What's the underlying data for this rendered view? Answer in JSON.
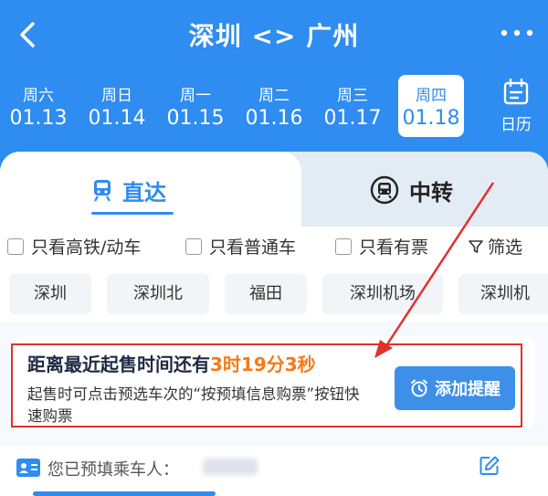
{
  "header": {
    "title": "深圳 <> 广州",
    "back_icon": "chevron-left-icon",
    "more_icon": "more-icon"
  },
  "dates": [
    {
      "weekday": "周六",
      "date": "01.13",
      "active": false
    },
    {
      "weekday": "周日",
      "date": "01.14",
      "active": false
    },
    {
      "weekday": "周一",
      "date": "01.15",
      "active": false
    },
    {
      "weekday": "周二",
      "date": "01.16",
      "active": false
    },
    {
      "weekday": "周三",
      "date": "01.17",
      "active": false
    },
    {
      "weekday": "周四",
      "date": "01.18",
      "active": true
    }
  ],
  "calendar": {
    "label": "日历",
    "icon": "calendar-icon"
  },
  "tabs": {
    "direct": "直达",
    "transfer": "中转"
  },
  "filters": {
    "high_speed": "只看高铁/动车",
    "normal": "只看普通车",
    "available": "只看有票",
    "screen": "筛选"
  },
  "stations": [
    "深圳",
    "深圳北",
    "福田",
    "深圳机场",
    "深圳机"
  ],
  "notice": {
    "title_prefix": "距离最近起售时间还有",
    "countdown": "3时19分3秒",
    "desc": "起售时可点击预选车次的“按预填信息购票”按钮快速购票",
    "remind_button": "添加提醒"
  },
  "passenger": {
    "label": "您已预填乘车人："
  },
  "colors": {
    "accent": "#2f8cf0",
    "countdown": "#f47a1a",
    "highlight_box": "#e0312c"
  }
}
